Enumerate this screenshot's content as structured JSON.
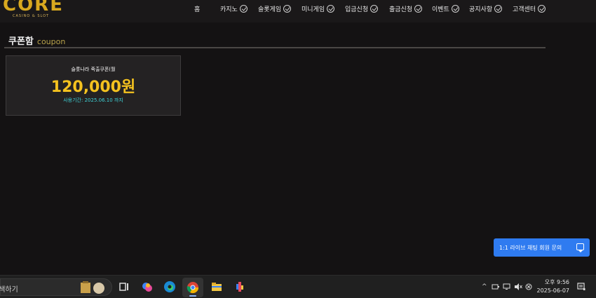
{
  "logo": {
    "text": "CORE",
    "subtitle": "CASINO & SLOT"
  },
  "nav": [
    {
      "label": "홈",
      "check": false
    },
    {
      "label": "카지노",
      "check": true
    },
    {
      "label": "슬롯게임",
      "check": true
    },
    {
      "label": "미니게임",
      "check": true
    },
    {
      "label": "입금신청",
      "check": true
    },
    {
      "label": "출금신청",
      "check": true
    },
    {
      "label": "이벤트",
      "check": true
    },
    {
      "label": "공지사항",
      "check": true
    },
    {
      "label": "고객센터",
      "check": true
    }
  ],
  "section": {
    "title": "쿠폰함",
    "subtitle": "coupon"
  },
  "coupon": {
    "name": "슬롯나라 죽출쿠폰(월",
    "amount": "120,000원",
    "period": "사용기간: 2025.06.10 까지"
  },
  "chat": {
    "label": "1:1 라이브 채팅 회원 문의"
  },
  "taskbar": {
    "search_text": "검색하기",
    "clock_line1": "오후 9:56",
    "clock_line2": "2025-06-07",
    "tray_chevron": "^"
  },
  "colors": {
    "background": "#141213",
    "accent_gold": "#f4c21f",
    "period_cyan": "#3fd3d8",
    "chat_blue": "#2f7bf0"
  }
}
